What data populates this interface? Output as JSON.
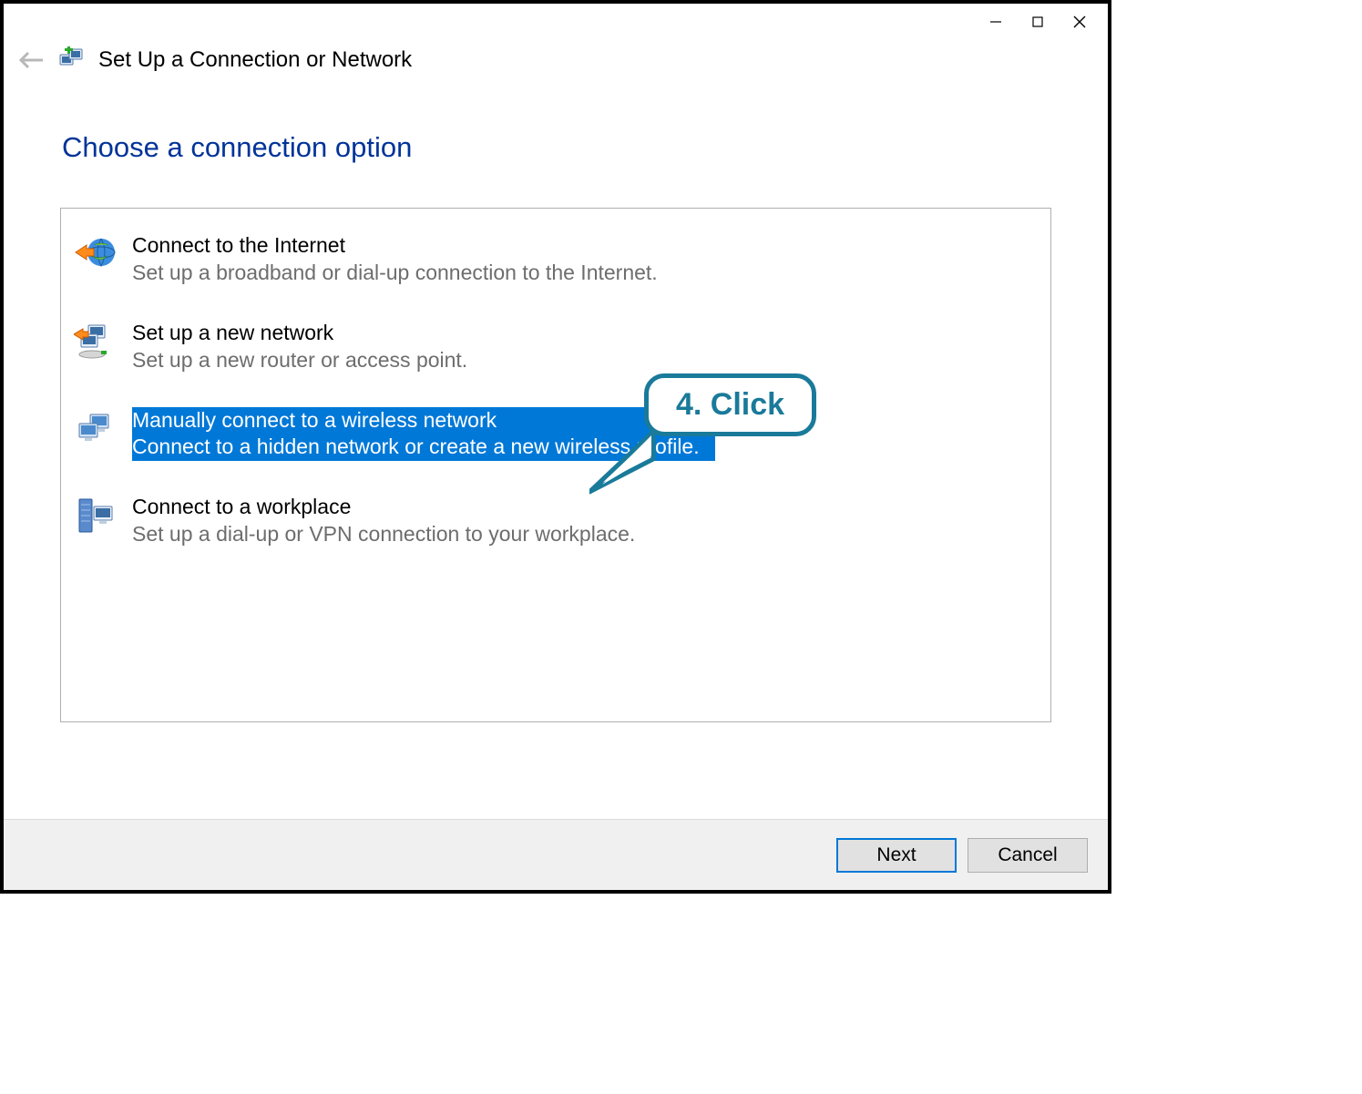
{
  "window": {
    "title": "Set Up a Connection or Network"
  },
  "heading": "Choose a connection option",
  "options": [
    {
      "title": "Connect to the Internet",
      "desc": "Set up a broadband or dial-up connection to the Internet.",
      "icon": "globe-arrow-icon",
      "selected": false
    },
    {
      "title": "Set up a new network",
      "desc": "Set up a new router or access point.",
      "icon": "network-devices-icon",
      "selected": false
    },
    {
      "title": "Manually connect to a wireless network",
      "desc": "Connect to a hidden network or create a new wireless profile.",
      "icon": "wireless-devices-icon",
      "selected": true
    },
    {
      "title": "Connect to a workplace",
      "desc": "Set up a dial-up or VPN connection to your workplace.",
      "icon": "workplace-server-icon",
      "selected": false
    }
  ],
  "buttons": {
    "next": "Next",
    "cancel": "Cancel"
  },
  "callout": {
    "label": "4. Click"
  },
  "colors": {
    "selection": "#0078d7",
    "heading": "#003399",
    "callout": "#1a7a9a"
  }
}
